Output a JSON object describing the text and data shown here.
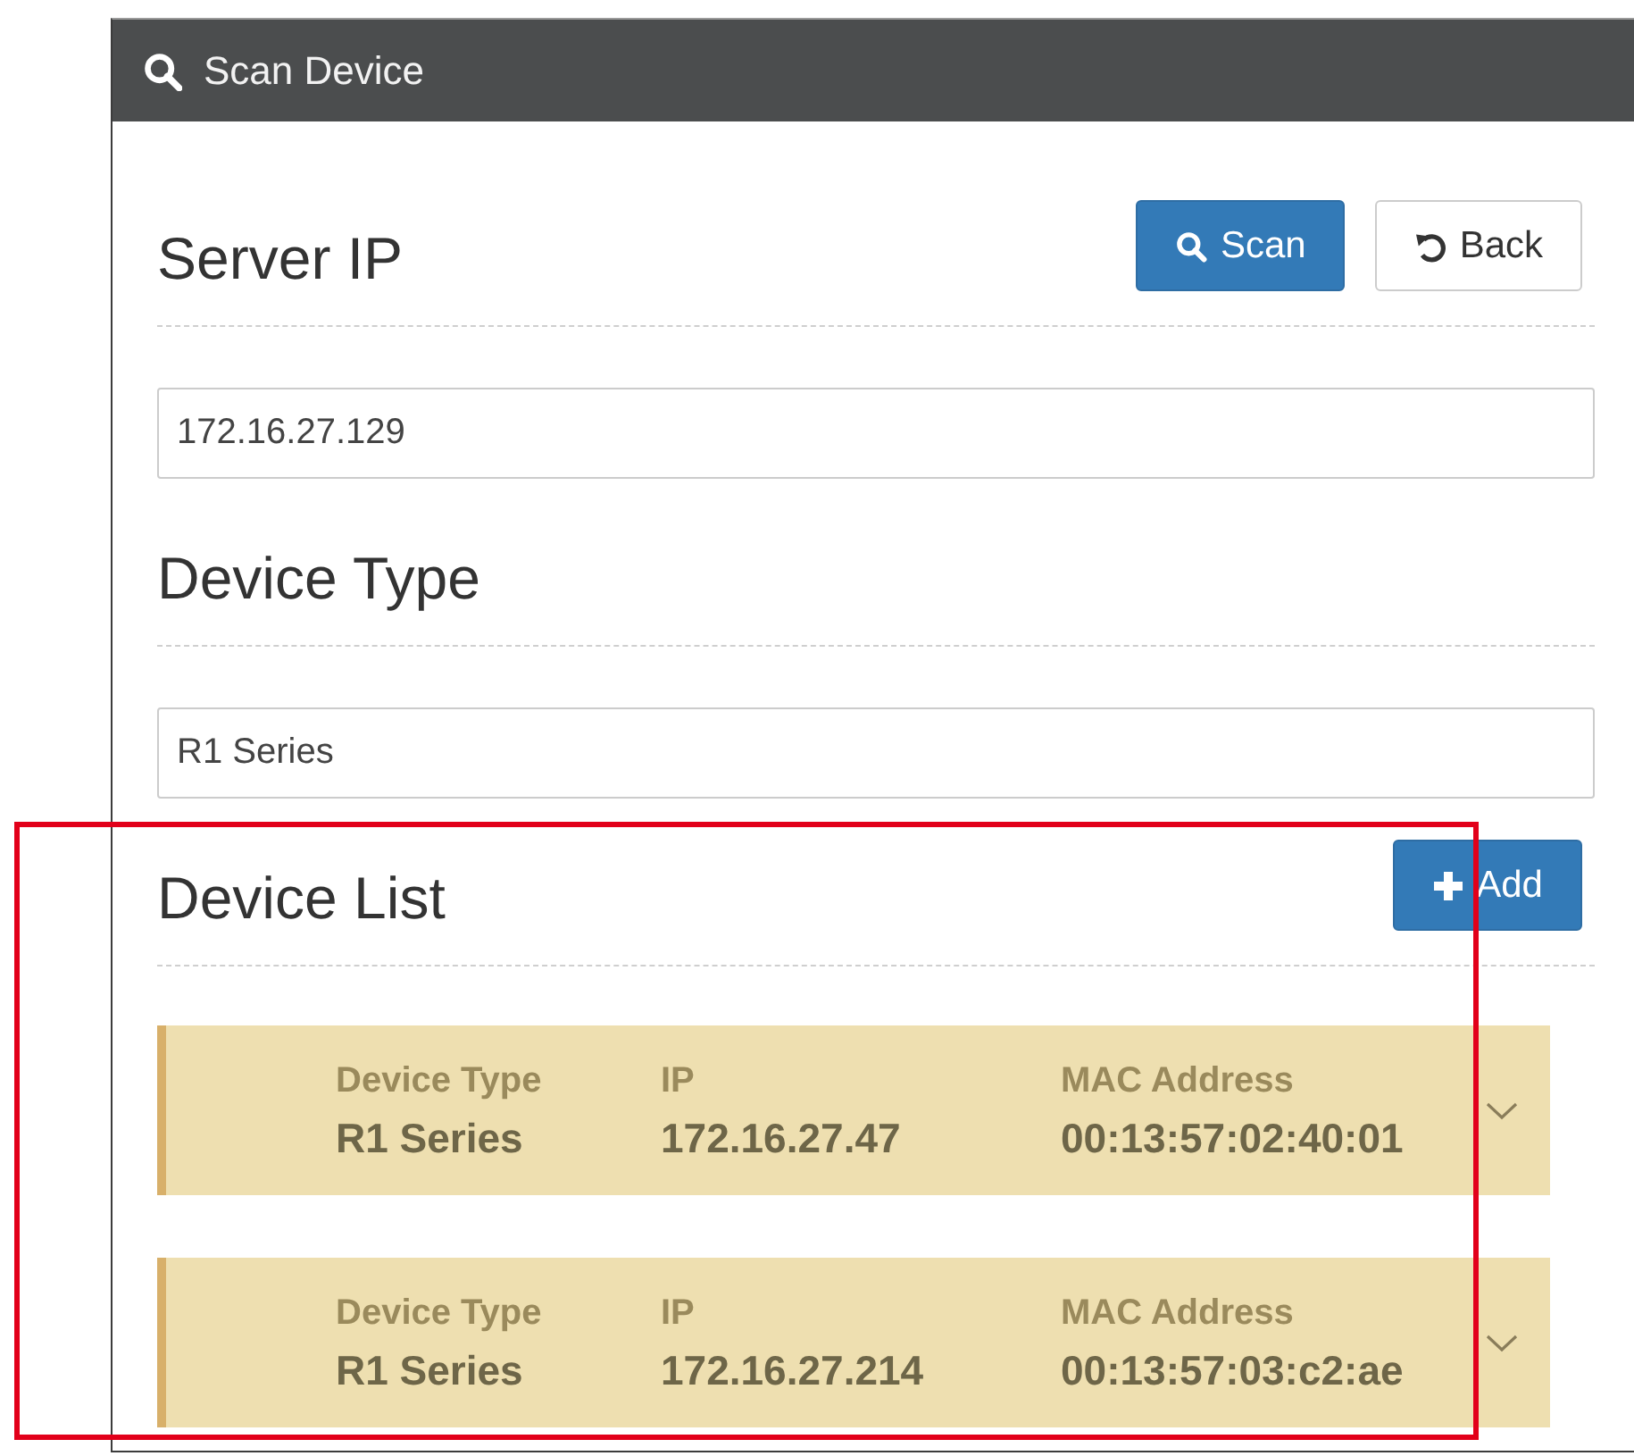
{
  "window": {
    "title": "Scan Device"
  },
  "sections": [
    {
      "kind": "field",
      "heading": "Server IP",
      "buttons": [
        {
          "label": "Scan",
          "kind": "scan"
        },
        {
          "label": "Back",
          "kind": "back"
        }
      ],
      "value": "172.16.27.129"
    },
    {
      "kind": "field",
      "heading": "Device Type",
      "value": "R1 Series"
    },
    {
      "kind": "list",
      "heading": "Device List",
      "buttons": [
        {
          "label": "Add",
          "kind": "add"
        }
      ],
      "devices": [
        {
          "expanded": false,
          "fields": [
            {
              "label": "Device Type",
              "value": "R1 Series"
            },
            {
              "label": "IP",
              "value": "172.16.27.47"
            },
            {
              "label": "MAC Address",
              "value": "00:13:57:02:40:01"
            }
          ]
        },
        {
          "expanded": false,
          "fields": [
            {
              "label": "Device Type",
              "value": "R1 Series"
            },
            {
              "label": "IP",
              "value": "172.16.27.214"
            },
            {
              "label": "MAC Address",
              "value": "00:13:57:03:c2:ae"
            }
          ]
        }
      ]
    }
  ]
}
